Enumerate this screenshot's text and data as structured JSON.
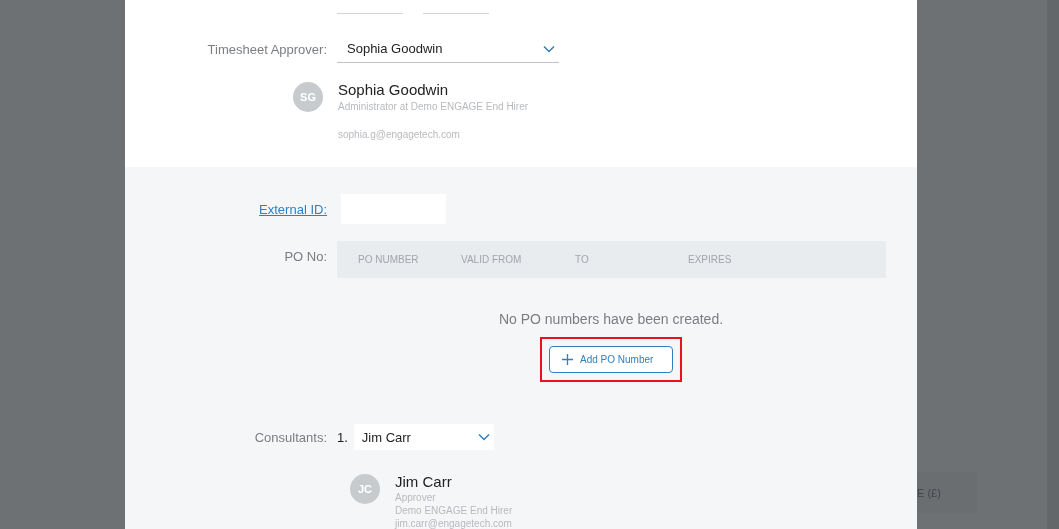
{
  "working_hours": {
    "fields": [
      {
        "kind": "time"
      },
      {
        "kind": "time"
      }
    ]
  },
  "timesheet_approver": {
    "label": "Timesheet Approver:",
    "value": "Sophia Goodwin"
  },
  "approver_card": {
    "initials": "SG",
    "name": "Sophia Goodwin",
    "role": "Administrator at Demo ENGAGE End Hirer",
    "email": "sophia.g@engagetech.com"
  },
  "external_id": {
    "label": "External ID:"
  },
  "po": {
    "label": "PO No:",
    "columns": [
      "PO NUMBER",
      "VALID FROM",
      "TO",
      "EXPIRES"
    ],
    "empty_message": "No PO numbers have been created.",
    "add_button": "Add PO Number"
  },
  "consultants": {
    "label": "Consultants:",
    "items": [
      {
        "index": "1.",
        "value": "Jim Carr",
        "initials": "JC",
        "name": "Jim Carr",
        "lines": [
          "Approver",
          "Demo ENGAGE End Hirer",
          "jim.carr@engagetech.com"
        ]
      }
    ]
  },
  "background": {
    "column_header": "E (£)"
  }
}
